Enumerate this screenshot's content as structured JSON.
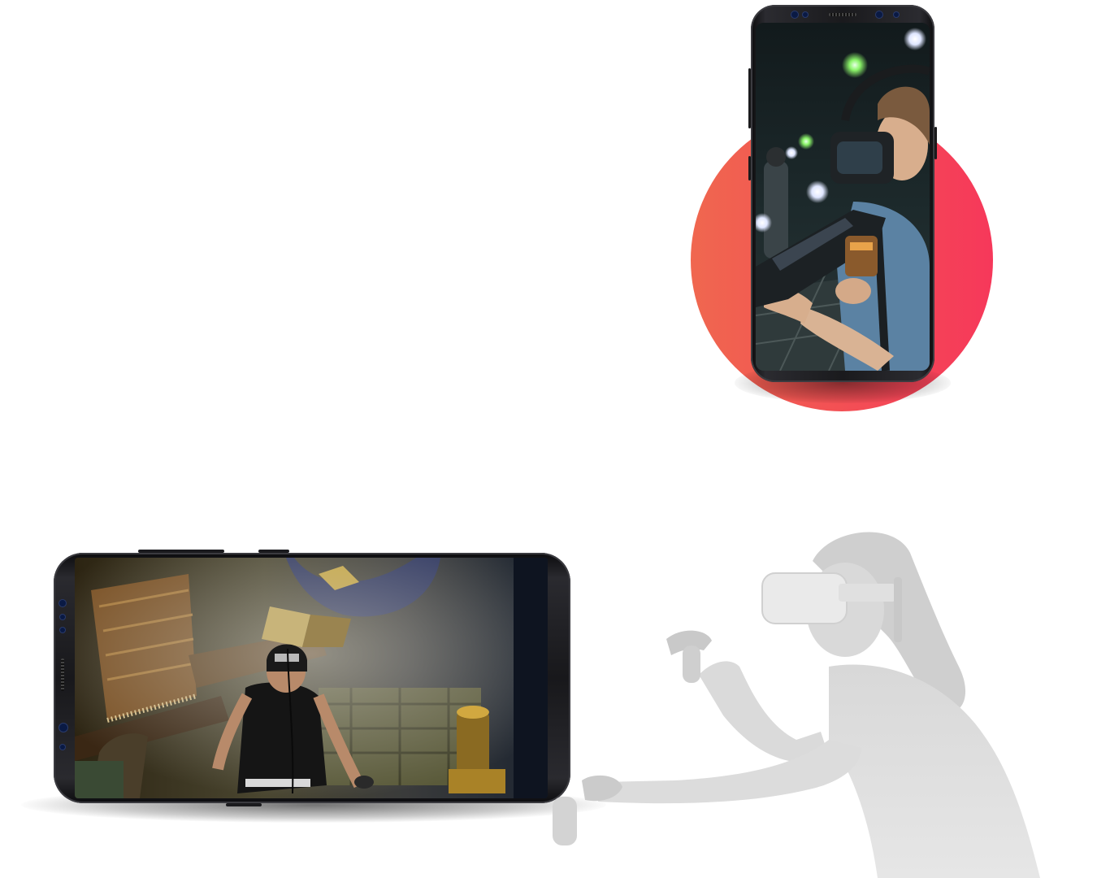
{
  "colors": {
    "circle_gradient_start": "#f0674f",
    "circle_gradient_end": "#f6385a",
    "phone_frame": "#1a1a1d",
    "faded_figure": "#dcdcdc"
  },
  "images": {
    "portrait_phone_screen": "vr-arena-player-with-headset-and-blaster-photo",
    "landscape_phone_screen": "vr-dungeon-game-player-photo",
    "background_figure": "woman-wearing-vr-headset-with-controllers-faded"
  }
}
